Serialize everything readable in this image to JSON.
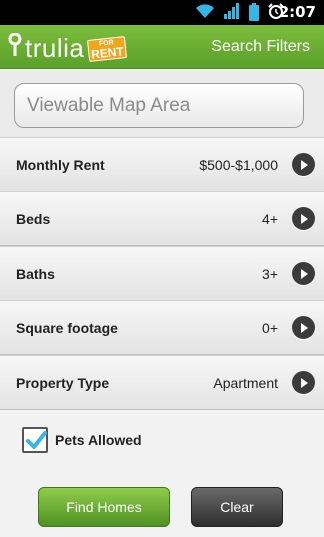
{
  "status_bar": {
    "time": "2:07",
    "icons": [
      "wifi-icon",
      "signal-icon",
      "battery-icon",
      "alarm-icon"
    ]
  },
  "app_bar": {
    "logo_text": "trulia",
    "badge_top": "FOR",
    "badge_bottom": "RENT",
    "action": "Search Filters"
  },
  "search": {
    "placeholder": "Viewable Map Area"
  },
  "filters": [
    {
      "label": "Monthly Rent",
      "value": "$500-$1,000"
    },
    {
      "label": "Beds",
      "value": "4+"
    },
    {
      "label": "Baths",
      "value": "3+"
    },
    {
      "label": "Square footage",
      "value": "0+"
    },
    {
      "label": "Property Type",
      "value": "Apartment"
    }
  ],
  "pets": {
    "label": "Pets Allowed",
    "checked": true
  },
  "buttons": {
    "find": "Find Homes",
    "clear": "Clear"
  },
  "colors": {
    "brand_green": "#6bb034",
    "rent_badge": "#f1a51d",
    "checkmark": "#35b6e6"
  }
}
